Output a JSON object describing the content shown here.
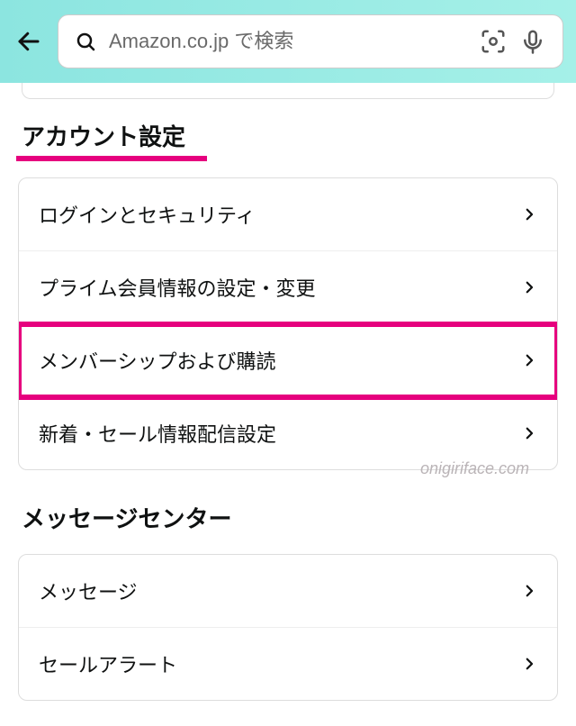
{
  "header": {
    "search_placeholder": "Amazon.co.jp で検索"
  },
  "sections": [
    {
      "title": "アカウント設定",
      "underlined": true,
      "items": [
        {
          "label": "ログインとセキュリティ"
        },
        {
          "label": "プライム会員情報の設定・変更"
        },
        {
          "label": "メンバーシップおよび購読",
          "highlighted": true
        },
        {
          "label": "新着・セール情報配信設定"
        }
      ]
    },
    {
      "title": "メッセージセンター",
      "underlined": false,
      "items": [
        {
          "label": "メッセージ"
        },
        {
          "label": "セールアラート"
        }
      ]
    }
  ],
  "watermark": "onigiriface.com"
}
